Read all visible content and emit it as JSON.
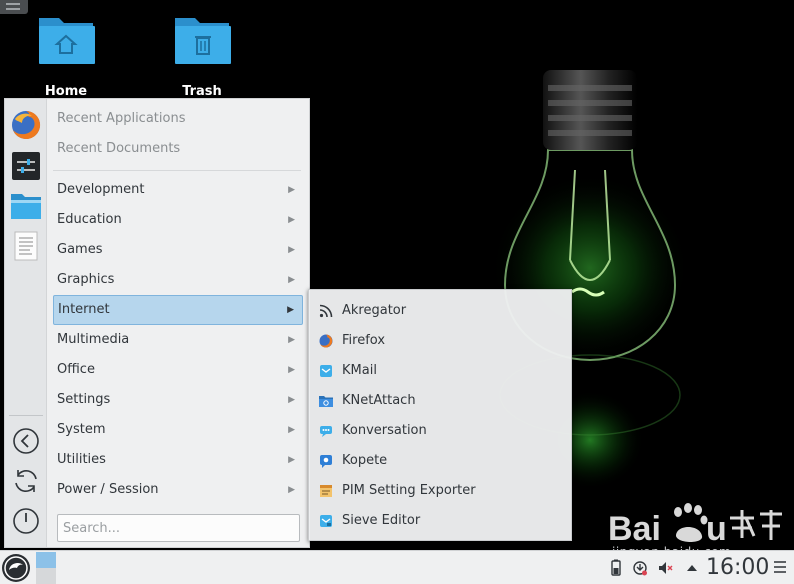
{
  "desktop": {
    "icons": [
      {
        "label": "Home",
        "icon": "home-folder-icon"
      },
      {
        "label": "Trash",
        "icon": "trash-folder-icon"
      }
    ]
  },
  "menu": {
    "sidebar_icons": [
      "firefox-icon",
      "system-settings-icon",
      "file-manager-icon",
      "text-editor-icon",
      "back-icon",
      "refresh-icon",
      "power-icon"
    ],
    "recent": [
      "Recent Applications",
      "Recent Documents"
    ],
    "categories": [
      {
        "label": "Development"
      },
      {
        "label": "Education"
      },
      {
        "label": "Games"
      },
      {
        "label": "Graphics"
      },
      {
        "label": "Internet",
        "active": true
      },
      {
        "label": "Multimedia"
      },
      {
        "label": "Office"
      },
      {
        "label": "Settings"
      },
      {
        "label": "System"
      },
      {
        "label": "Utilities"
      },
      {
        "label": "Power / Session"
      }
    ],
    "search_placeholder": "Search..."
  },
  "submenu": {
    "items": [
      {
        "label": "Akregator",
        "icon": "rss-feed-icon"
      },
      {
        "label": "Firefox",
        "icon": "firefox-icon"
      },
      {
        "label": "KMail",
        "icon": "kmail-icon"
      },
      {
        "label": "KNetAttach",
        "icon": "knetattach-icon"
      },
      {
        "label": "Konversation",
        "icon": "konversation-icon"
      },
      {
        "label": "Kopete",
        "icon": "kopete-icon"
      },
      {
        "label": "PIM Setting Exporter",
        "icon": "pim-exporter-icon"
      },
      {
        "label": "Sieve Editor",
        "icon": "sieve-editor-icon"
      }
    ]
  },
  "watermark": {
    "domain": "jingyan.baidu.com"
  },
  "panel": {
    "clock": "16:00",
    "tray_icons": [
      "battery-icon",
      "updates-icon",
      "volume-muted-icon",
      "expand-tray-icon"
    ]
  },
  "colors": {
    "menu_bg": "#eff0f1",
    "highlight": "#b6d6ed",
    "folder_blue": "#3daee9"
  }
}
